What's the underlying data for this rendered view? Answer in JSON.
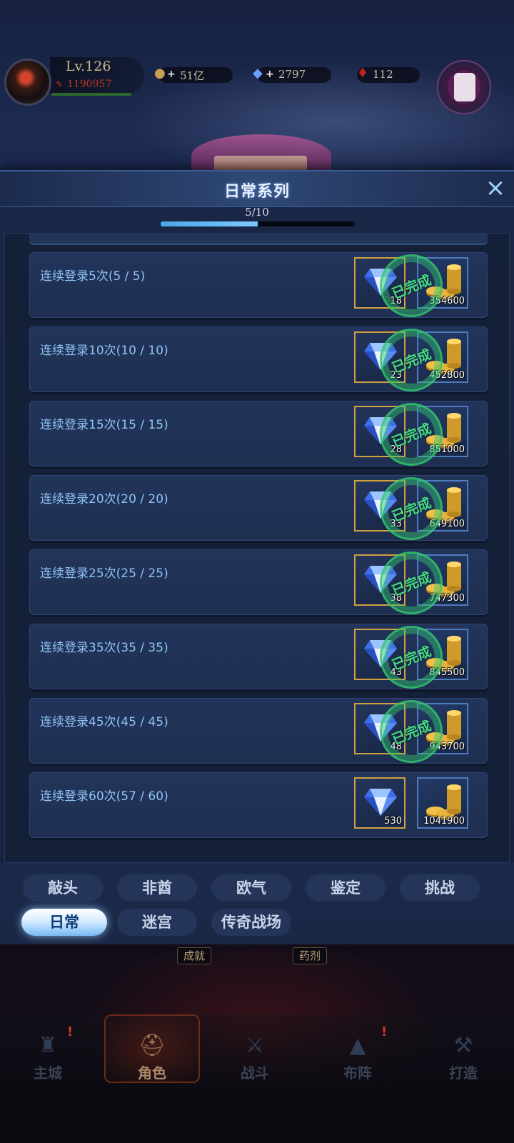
{
  "hud": {
    "level": "Lv.126",
    "power": "1190957",
    "gold": "51亿",
    "diamond": "2797",
    "ruby": "112"
  },
  "modal": {
    "title": "日常系列",
    "close_icon": "×",
    "progress_text": "5/10",
    "progress_value": 0.5,
    "completed_stamp": "已完成"
  },
  "tasks": [
    {
      "name": "连续登录5次(5 / 5)",
      "gem_qty": "18",
      "coin_qty": "354600",
      "completed": true
    },
    {
      "name": "连续登录10次(10 / 10)",
      "gem_qty": "23",
      "coin_qty": "452800",
      "completed": true
    },
    {
      "name": "连续登录15次(15 / 15)",
      "gem_qty": "28",
      "coin_qty": "851000",
      "completed": true
    },
    {
      "name": "连续登录20次(20 / 20)",
      "gem_qty": "33",
      "coin_qty": "649100",
      "completed": true
    },
    {
      "name": "连续登录25次(25 / 25)",
      "gem_qty": "38",
      "coin_qty": "747300",
      "completed": true
    },
    {
      "name": "连续登录35次(35 / 35)",
      "gem_qty": "43",
      "coin_qty": "845500",
      "completed": true
    },
    {
      "name": "连续登录45次(45 / 45)",
      "gem_qty": "48",
      "coin_qty": "943700",
      "completed": true
    },
    {
      "name": "连续登录60次(57 / 60)",
      "gem_qty": "530",
      "coin_qty": "1041900",
      "completed": false
    }
  ],
  "tabs": {
    "row1": [
      "敲头",
      "非酋",
      "欧气",
      "鉴定",
      "挑战"
    ],
    "row2": [
      "日常",
      "迷宫",
      "传奇战场"
    ],
    "active": "日常"
  },
  "under_labels": [
    "成就",
    "药剂"
  ],
  "bottom_nav": [
    {
      "label": "主城",
      "icon": "castle-icon"
    },
    {
      "label": "角色",
      "icon": "helmet-icon"
    },
    {
      "label": "战斗",
      "icon": "crossed-swords-icon"
    },
    {
      "label": "布阵",
      "icon": "formation-icon"
    },
    {
      "label": "打造",
      "icon": "anvil-icon"
    }
  ],
  "colors": {
    "accent": "#8fc3f3",
    "stamp": "#49d98a",
    "gem_frame": "#d1a040",
    "coin_frame": "#4f7bc0"
  }
}
